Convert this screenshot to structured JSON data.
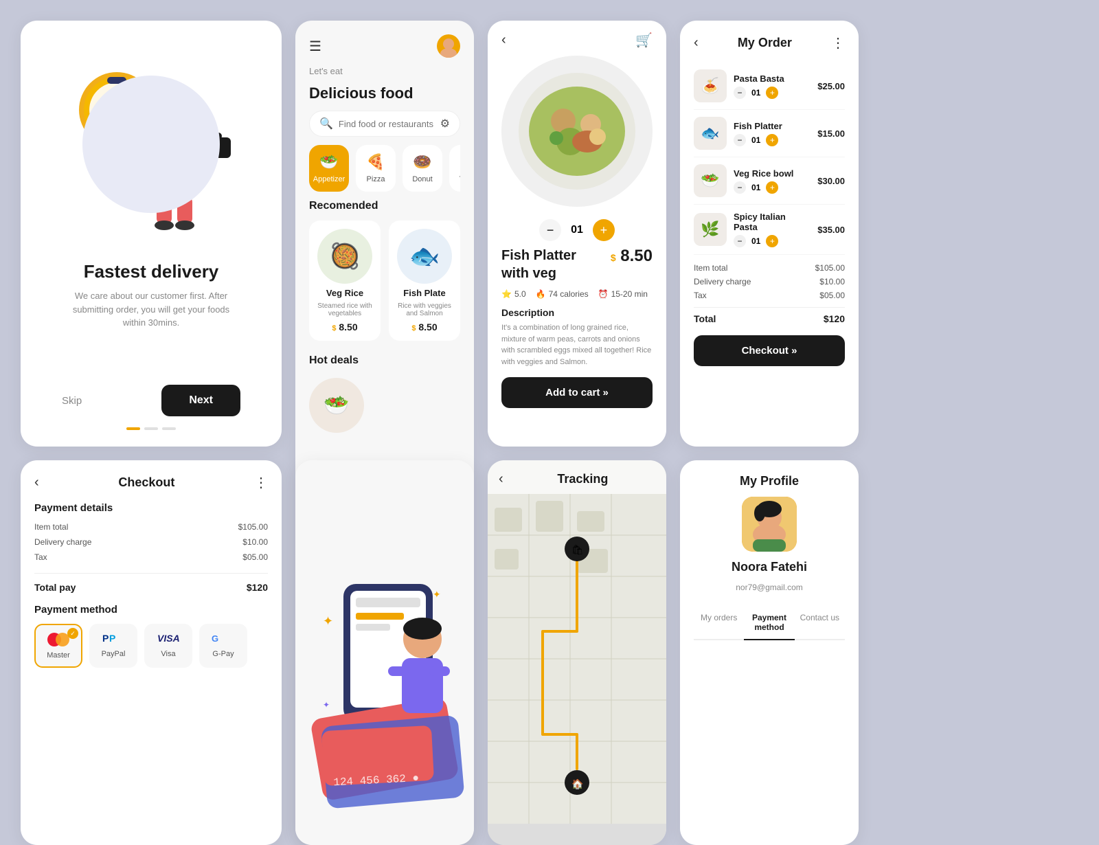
{
  "delivery": {
    "title": "Fastest delivery",
    "description": "We care about our customer first. After submitting order, you will get your foods within 30mins.",
    "skip_label": "Skip",
    "next_label": "Next"
  },
  "menu": {
    "greeting": "Let's eat",
    "title": "Delicious food",
    "search_placeholder": "Find food or restaurants",
    "categories": [
      {
        "label": "Appetizer",
        "icon": "🥗",
        "active": true
      },
      {
        "label": "Pizza",
        "icon": "🍕",
        "active": false
      },
      {
        "label": "Donut",
        "icon": "🍩",
        "active": false
      },
      {
        "label": "Tacos",
        "icon": "🌮",
        "active": false
      }
    ],
    "recommended_title": "Recomended",
    "recommended": [
      {
        "name": "Veg Rice",
        "desc": "Steamed rice with vegetables",
        "price": "8.50"
      },
      {
        "name": "Fish Plate",
        "desc": "Rice with veggies and Salmon",
        "price": "8.50"
      }
    ],
    "hot_deals_title": "Hot deals"
  },
  "detail": {
    "name": "Fish Platter\nwith veg",
    "price": "8.50",
    "rating": "5.0",
    "calories": "74 calories",
    "time": "15-20 min",
    "description_label": "Description",
    "description": "It's a combination of long grained rice, mixture of warm peas, carrots and onions with scrambled eggs mixed all together! Rice with veggies and Salmon.",
    "qty": "01",
    "add_to_cart_label": "Add to cart »"
  },
  "my_order": {
    "title": "My Order",
    "items": [
      {
        "name": "Pasta Basta",
        "qty": "01",
        "price": "$25.00"
      },
      {
        "name": "Fish Platter",
        "qty": "01",
        "price": "$15.00"
      },
      {
        "name": "Veg Rice bowl",
        "qty": "01",
        "price": "$30.00"
      },
      {
        "name": "Spicy Italian Pasta",
        "qty": "01",
        "price": "$35.00"
      }
    ],
    "item_total_label": "Item total",
    "item_total": "$105.00",
    "delivery_charge_label": "Delivery charge",
    "delivery_charge": "$10.00",
    "tax_label": "Tax",
    "tax": "$05.00",
    "total_label": "Total",
    "total": "$120",
    "checkout_label": "Checkout »"
  },
  "checkout": {
    "title": "Checkout",
    "payment_details_label": "Payment details",
    "item_total_label": "Item total",
    "item_total": "$105.00",
    "delivery_charge_label": "Delivery charge",
    "delivery_charge": "$10.00",
    "tax_label": "Tax",
    "tax": "$05.00",
    "total_pay_label": "Total pay",
    "total_pay": "$120",
    "payment_method_label": "Payment method",
    "methods": [
      {
        "name": "Master",
        "selected": true
      },
      {
        "name": "PayPal",
        "selected": false
      },
      {
        "name": "Visa",
        "selected": false
      },
      {
        "name": "G-Pay",
        "selected": false
      }
    ]
  },
  "tracking": {
    "title": "Tracking"
  },
  "profile": {
    "title": "My Profile",
    "name": "Noora Fatehi",
    "email": "nor79@gmail.com",
    "tabs": [
      {
        "label": "My orders",
        "active": false
      },
      {
        "label": "Payment method",
        "active": true
      },
      {
        "label": "Contact us",
        "active": false
      }
    ]
  },
  "colors": {
    "accent": "#f0a500",
    "dark": "#1a1a1a",
    "light_bg": "#f7f7f7"
  }
}
